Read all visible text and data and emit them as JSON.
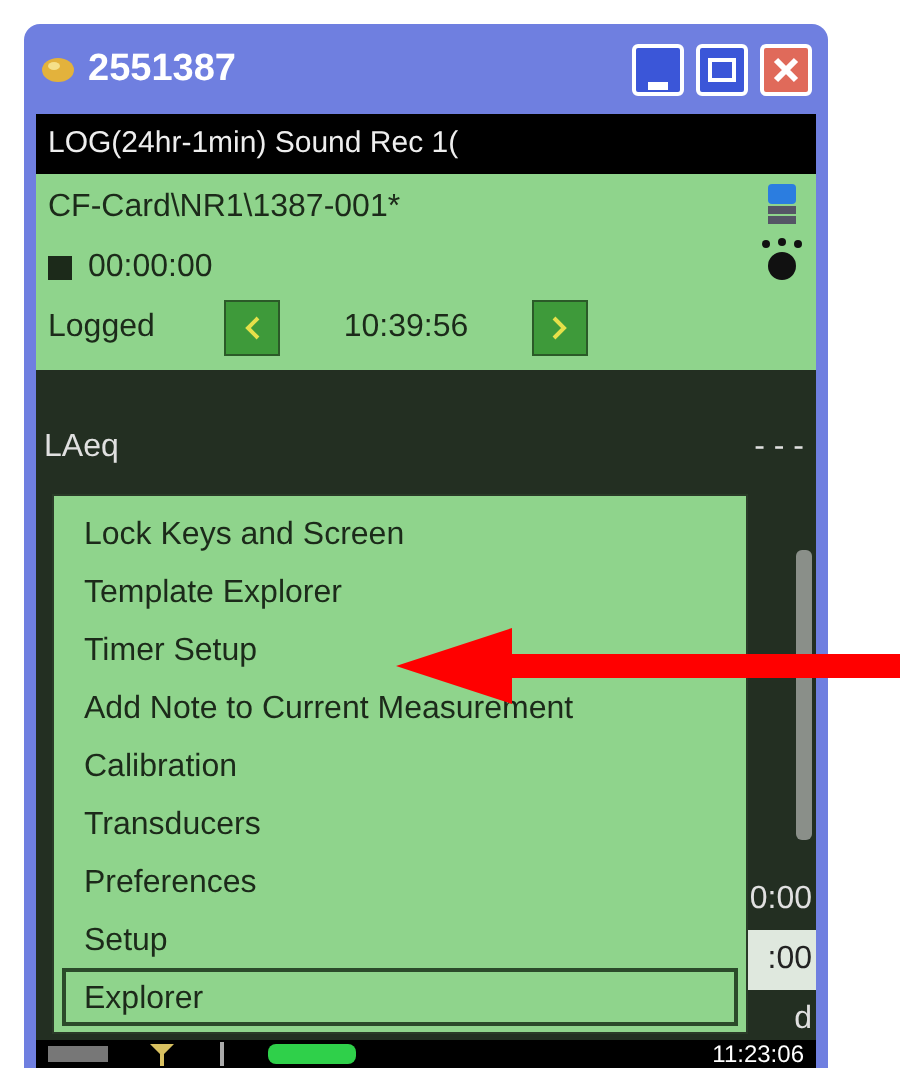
{
  "window": {
    "title": "2551387"
  },
  "header": {
    "mode": "LOG(24hr-1min) Sound Rec 1(",
    "path": "CF-Card\\NR1\\1387-001*",
    "elapsed": "00:00:00",
    "state": "Logged",
    "time": "10:39:56"
  },
  "display": {
    "parameter": "LAeq",
    "value": "- - -",
    "fragments": [
      "0:00",
      ":00",
      "d"
    ]
  },
  "menu": {
    "items": [
      {
        "label": "Lock Keys and Screen",
        "selected": false
      },
      {
        "label": "Template Explorer",
        "selected": false
      },
      {
        "label": "Timer Setup",
        "selected": false
      },
      {
        "label": "Add Note to Current Measurement",
        "selected": false
      },
      {
        "label": "Calibration",
        "selected": false
      },
      {
        "label": "Transducers",
        "selected": false
      },
      {
        "label": "Preferences",
        "selected": false
      },
      {
        "label": "Setup",
        "selected": false
      },
      {
        "label": "Explorer",
        "selected": true
      }
    ]
  },
  "status_bar": {
    "clock": "11:23:06"
  }
}
